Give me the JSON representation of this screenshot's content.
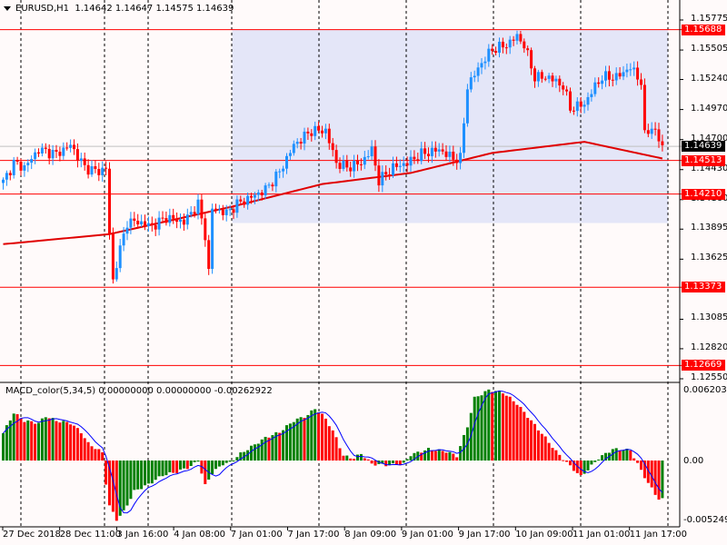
{
  "header": {
    "symbol": "EURUSD,H1",
    "open": "1.14642",
    "high": "1.14647",
    "low": "1.14575",
    "close": "1.14639"
  },
  "macd_header": {
    "name": "MACD_color(5,34,5)",
    "v1": "0.00000000",
    "v2": "0.00000000",
    "v3": "-0.00262922"
  },
  "colors": {
    "bull": "#1e90ff",
    "bear": "#ff0000",
    "ma": "#e00000",
    "hist_up": "#008000",
    "hist_down": "#ff0000",
    "signal": "#0000ff",
    "zone": "#e4e6f8",
    "level": "#ff0000",
    "background": "#fffafa"
  },
  "price_axis": [
    "1.15775",
    "1.15505",
    "1.15240",
    "1.14970",
    "1.14700",
    "1.14430",
    "1.14160",
    "1.13895",
    "1.13625",
    "1.13085",
    "1.12820",
    "1.12550"
  ],
  "levels": [
    {
      "price": 1.15688,
      "label": "1.15688"
    },
    {
      "price": 1.14513,
      "label": "1.14513"
    },
    {
      "price": 1.1421,
      "label": "1.14210"
    },
    {
      "price": 1.13373,
      "label": "1.13373"
    },
    {
      "price": 1.12669,
      "label": "1.12669"
    }
  ],
  "current_price": {
    "price": 1.14639,
    "label": "1.14639"
  },
  "zone": {
    "from_bar": 65,
    "to_bar": 188,
    "top": 1.15688,
    "bottom": 1.1395
  },
  "macd_axis": {
    "top": "0.0062035",
    "zero": "0.00",
    "bottom": "-0.005249"
  },
  "time_axis": [
    "27 Dec 2018",
    "28 Dec 11:00",
    "3 Jan 16:00",
    "4 Jan 08:00",
    "7 Jan 01:00",
    "7 Jan 17:00",
    "8 Jan 09:00",
    "9 Jan 01:00",
    "9 Jan 17:00",
    "10 Jan 09:00",
    "11 Jan 01:00",
    "11 Jan 17:00"
  ],
  "chart_data": {
    "type": "candlestick",
    "bars": 187,
    "close_anchors": [
      [
        0,
        1.1432
      ],
      [
        3,
        1.1449
      ],
      [
        6,
        1.1445
      ],
      [
        10,
        1.1461
      ],
      [
        15,
        1.1457
      ],
      [
        19,
        1.1465
      ],
      [
        23,
        1.1445
      ],
      [
        27,
        1.1441
      ],
      [
        29,
        1.1445
      ],
      [
        30,
        1.1384
      ],
      [
        31,
        1.1343
      ],
      [
        32,
        1.1359
      ],
      [
        35,
        1.1396
      ],
      [
        38,
        1.1396
      ],
      [
        42,
        1.1392
      ],
      [
        46,
        1.14
      ],
      [
        51,
        1.1396
      ],
      [
        55,
        1.1412
      ],
      [
        57,
        1.1384
      ],
      [
        58,
        1.1351
      ],
      [
        59,
        1.1408
      ],
      [
        63,
        1.1404
      ],
      [
        66,
        1.1412
      ],
      [
        71,
        1.142
      ],
      [
        74,
        1.1425
      ],
      [
        78,
        1.1441
      ],
      [
        82,
        1.1465
      ],
      [
        87,
        1.1478
      ],
      [
        91,
        1.1478
      ],
      [
        94,
        1.1449
      ],
      [
        97,
        1.1445
      ],
      [
        101,
        1.1449
      ],
      [
        104,
        1.1461
      ],
      [
        106,
        1.1433
      ],
      [
        110,
        1.1445
      ],
      [
        114,
        1.1449
      ],
      [
        118,
        1.1457
      ],
      [
        123,
        1.1461
      ],
      [
        127,
        1.1453
      ],
      [
        129,
        1.1453
      ],
      [
        131,
        1.1518
      ],
      [
        135,
        1.1539
      ],
      [
        138,
        1.1551
      ],
      [
        142,
        1.1555
      ],
      [
        145,
        1.1563
      ],
      [
        147,
        1.1555
      ],
      [
        150,
        1.1526
      ],
      [
        154,
        1.1526
      ],
      [
        158,
        1.1518
      ],
      [
        160,
        1.1498
      ],
      [
        164,
        1.1502
      ],
      [
        167,
        1.1518
      ],
      [
        169,
        1.1526
      ],
      [
        173,
        1.1526
      ],
      [
        177,
        1.1535
      ],
      [
        180,
        1.1522
      ],
      [
        181,
        1.1473
      ],
      [
        183,
        1.1482
      ],
      [
        186,
        1.1464
      ]
    ],
    "ma_anchors": [
      [
        0,
        1.1376
      ],
      [
        30,
        1.1385
      ],
      [
        65,
        1.141
      ],
      [
        90,
        1.143
      ],
      [
        115,
        1.144
      ],
      [
        138,
        1.1458
      ],
      [
        164,
        1.1468
      ],
      [
        186,
        1.1453
      ]
    ],
    "macd_hist_anchors": [
      [
        0,
        0.0024
      ],
      [
        3,
        0.0042
      ],
      [
        6,
        0.0035
      ],
      [
        10,
        0.0033
      ],
      [
        12,
        0.0039
      ],
      [
        15,
        0.0035
      ],
      [
        19,
        0.0033
      ],
      [
        22,
        0.0025
      ],
      [
        24,
        0.0015
      ],
      [
        28,
        0.0007
      ],
      [
        29,
        -0.002
      ],
      [
        30,
        -0.004
      ],
      [
        32,
        -0.0052
      ],
      [
        34,
        -0.0045
      ],
      [
        37,
        -0.0027
      ],
      [
        41,
        -0.0021
      ],
      [
        45,
        -0.0013
      ],
      [
        49,
        -0.001
      ],
      [
        53,
        -0.0005
      ],
      [
        55,
        0.0
      ],
      [
        57,
        -0.0022
      ],
      [
        59,
        -0.0011
      ],
      [
        62,
        -0.0003
      ],
      [
        64,
        -0.0002
      ],
      [
        67,
        0.0006
      ],
      [
        71,
        0.0014
      ],
      [
        74,
        0.002
      ],
      [
        78,
        0.0025
      ],
      [
        82,
        0.0035
      ],
      [
        86,
        0.004
      ],
      [
        88,
        0.0046
      ],
      [
        91,
        0.0037
      ],
      [
        94,
        0.002
      ],
      [
        96,
        0.0004
      ],
      [
        99,
        0.0002
      ],
      [
        101,
        0.0006
      ],
      [
        104,
        -0.0003
      ],
      [
        108,
        -0.0004
      ],
      [
        113,
        -0.0003
      ],
      [
        115,
        0.0005
      ],
      [
        120,
        0.001
      ],
      [
        125,
        0.0008
      ],
      [
        128,
        0.0004
      ],
      [
        131,
        0.003
      ],
      [
        133,
        0.0055
      ],
      [
        137,
        0.0062
      ],
      [
        141,
        0.006
      ],
      [
        145,
        0.005
      ],
      [
        149,
        0.0035
      ],
      [
        153,
        0.002
      ],
      [
        156,
        0.0008
      ],
      [
        160,
        -0.0005
      ],
      [
        163,
        -0.0014
      ],
      [
        165,
        -0.0008
      ],
      [
        168,
        0.0002
      ],
      [
        172,
        0.001
      ],
      [
        177,
        0.0009
      ],
      [
        179,
        -0.0003
      ],
      [
        182,
        -0.002
      ],
      [
        185,
        -0.0034
      ]
    ]
  }
}
